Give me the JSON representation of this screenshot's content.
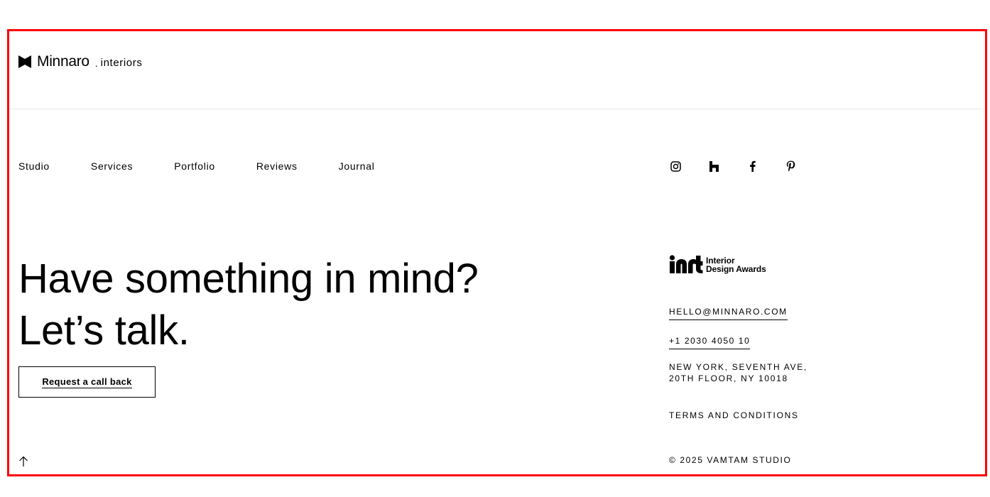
{
  "header": {
    "brand_name": "Minnaro",
    "brand_separator": ".",
    "brand_sub": "interiors"
  },
  "nav": {
    "items": [
      {
        "label": "Studio"
      },
      {
        "label": "Services"
      },
      {
        "label": "Portfolio"
      },
      {
        "label": "Reviews"
      },
      {
        "label": "Journal"
      }
    ]
  },
  "social": {
    "icons": [
      "instagram-icon",
      "houzz-icon",
      "facebook-icon",
      "pinterest-icon"
    ]
  },
  "hero": {
    "headline_line1": "Have something in mind?",
    "headline_line2": "Let’s talk.",
    "cta_label": "Request a call back"
  },
  "award": {
    "mark": "int",
    "line1": "Interior",
    "line2": "Design Awards"
  },
  "contact": {
    "email": "HELLO@MINNARO.COM",
    "phone": "+1 2030 4050 10",
    "address_line1": "NEW YORK, SEVENTH AVE,",
    "address_line2": "20TH FLOOR, NY 10018"
  },
  "footer": {
    "terms_label": "TERMS AND CONDITIONS",
    "copyright": "© 2025 VAMTAM STUDIO"
  },
  "colors": {
    "highlight_frame": "#ff0000",
    "text": "#000000",
    "background": "#ffffff",
    "divider": "#e6e6e6"
  }
}
